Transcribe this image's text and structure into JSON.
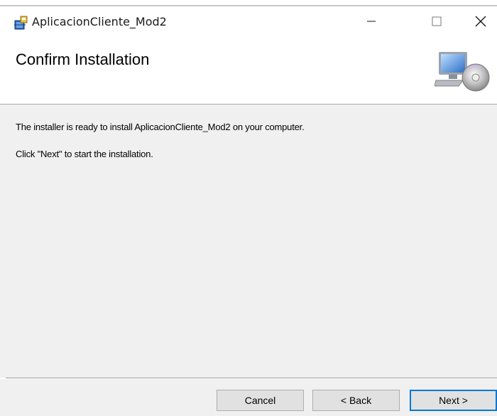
{
  "window": {
    "title": "AplicacionCliente_Mod2",
    "icons": [
      "installer-icon",
      "minimize-icon",
      "maximize-icon",
      "close-icon"
    ]
  },
  "header": {
    "title": "Confirm Installation",
    "graphic": "computer-cd-icon"
  },
  "body": {
    "message1": "The installer is ready to install AplicacionCliente_Mod2 on your computer.",
    "message2": "Click \"Next\" to start the installation."
  },
  "footer": {
    "cancel_label": "Cancel",
    "back_label": "< Back",
    "next_label": "Next >"
  },
  "colors": {
    "content_bg": "#f0f0f0",
    "focus_border": "#0078d7"
  }
}
